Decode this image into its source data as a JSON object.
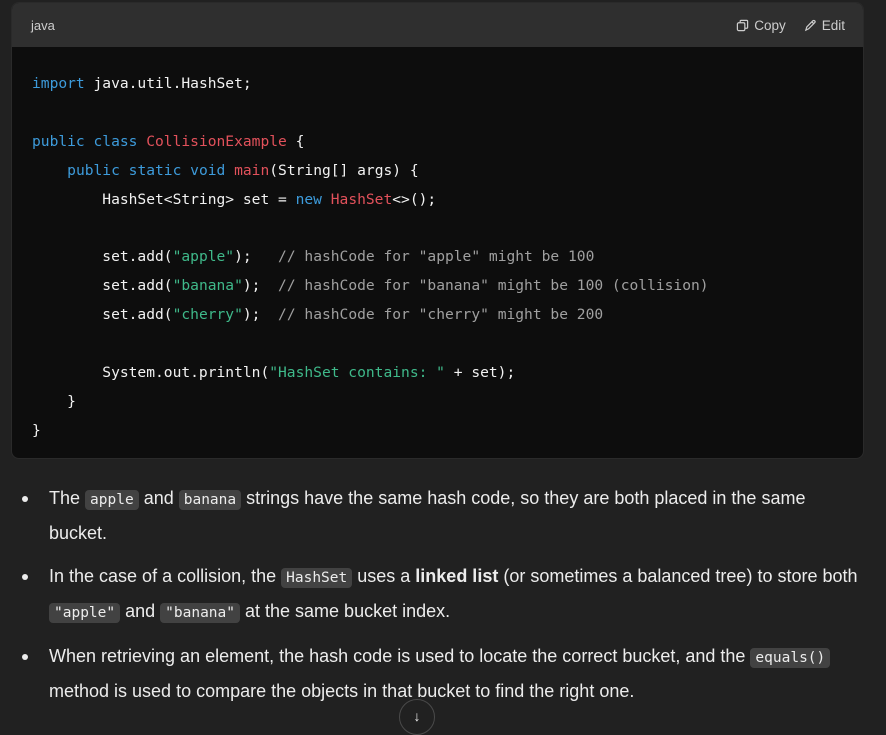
{
  "code_block": {
    "language": "java",
    "copy_label": "Copy",
    "edit_label": "Edit",
    "lines": [
      [
        {
          "t": "kw",
          "v": "import"
        },
        {
          "t": "",
          "v": " java.util.HashSet;"
        }
      ],
      [],
      [
        {
          "t": "kw",
          "v": "public class"
        },
        {
          "t": "",
          "v": " "
        },
        {
          "t": "ty",
          "v": "CollisionExample"
        },
        {
          "t": "",
          "v": " {"
        }
      ],
      [
        {
          "t": "",
          "v": "    "
        },
        {
          "t": "kw",
          "v": "public static void"
        },
        {
          "t": "",
          "v": " "
        },
        {
          "t": "ty",
          "v": "main"
        },
        {
          "t": "",
          "v": "(String[] args) {"
        }
      ],
      [
        {
          "t": "",
          "v": "        HashSet<String> set = "
        },
        {
          "t": "kw",
          "v": "new"
        },
        {
          "t": "",
          "v": " "
        },
        {
          "t": "ty",
          "v": "HashSet"
        },
        {
          "t": "",
          "v": "<>();"
        }
      ],
      [],
      [
        {
          "t": "",
          "v": "        set.add("
        },
        {
          "t": "st",
          "v": "\"apple\""
        },
        {
          "t": "",
          "v": ");   "
        },
        {
          "t": "cm",
          "v": "// hashCode for \"apple\" might be 100"
        }
      ],
      [
        {
          "t": "",
          "v": "        set.add("
        },
        {
          "t": "st",
          "v": "\"banana\""
        },
        {
          "t": "",
          "v": ");  "
        },
        {
          "t": "cm",
          "v": "// hashCode for \"banana\" might be 100 (collision)"
        }
      ],
      [
        {
          "t": "",
          "v": "        set.add("
        },
        {
          "t": "st",
          "v": "\"cherry\""
        },
        {
          "t": "",
          "v": ");  "
        },
        {
          "t": "cm",
          "v": "// hashCode for \"cherry\" might be 200"
        }
      ],
      [],
      [
        {
          "t": "",
          "v": "        System.out.println("
        },
        {
          "t": "st",
          "v": "\"HashSet contains: \""
        },
        {
          "t": "",
          "v": " + set);"
        }
      ],
      [
        {
          "t": "",
          "v": "    }"
        }
      ],
      [
        {
          "t": "",
          "v": "}"
        }
      ]
    ]
  },
  "bullets": [
    [
      {
        "t": "text",
        "v": "The "
      },
      {
        "t": "code",
        "v": "apple"
      },
      {
        "t": "text",
        "v": " and "
      },
      {
        "t": "code",
        "v": "banana"
      },
      {
        "t": "text",
        "v": " strings have the same hash code, so they are both placed in the same bucket."
      }
    ],
    [
      {
        "t": "text",
        "v": "In the case of a collision, the "
      },
      {
        "t": "code",
        "v": "HashSet"
      },
      {
        "t": "text",
        "v": " uses a "
      },
      {
        "t": "bold",
        "v": "linked list"
      },
      {
        "t": "text",
        "v": " (or sometimes a balanced tree) to store both "
      },
      {
        "t": "code",
        "v": "\"apple\""
      },
      {
        "t": "text",
        "v": " and "
      },
      {
        "t": "code",
        "v": "\"banana\""
      },
      {
        "t": "text",
        "v": " at the same bucket index."
      }
    ],
    [
      {
        "t": "text",
        "v": "When retrieving an element, the hash code is used to locate the correct bucket, and the "
      },
      {
        "t": "code",
        "v": "equals()"
      },
      {
        "t": "text",
        "v": " method is used to compare the objects in that bucket to find the right one."
      }
    ]
  ],
  "scroll_button": {
    "icon": "arrow-down-icon",
    "glyph": "↓"
  }
}
